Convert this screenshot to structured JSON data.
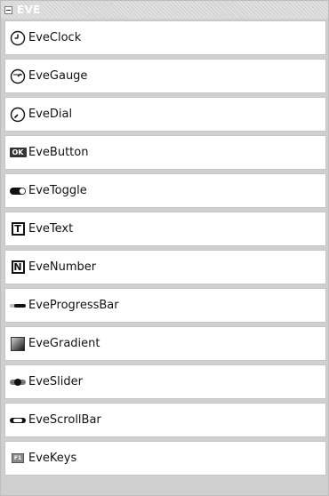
{
  "group": {
    "title": "EVE"
  },
  "items": [
    {
      "label": "EveClock",
      "icon": "clock-icon"
    },
    {
      "label": "EveGauge",
      "icon": "gauge-icon"
    },
    {
      "label": "EveDial",
      "icon": "dial-icon"
    },
    {
      "label": "EveButton",
      "icon": "ok-button-icon",
      "icon_text": "OK"
    },
    {
      "label": "EveToggle",
      "icon": "toggle-icon"
    },
    {
      "label": "EveText",
      "icon": "text-icon",
      "icon_text": "T"
    },
    {
      "label": "EveNumber",
      "icon": "number-icon",
      "icon_text": "N"
    },
    {
      "label": "EveProgressBar",
      "icon": "progress-bar-icon"
    },
    {
      "label": "EveGradient",
      "icon": "gradient-icon"
    },
    {
      "label": "EveSlider",
      "icon": "slider-icon"
    },
    {
      "label": "EveScrollBar",
      "icon": "scrollbar-icon"
    },
    {
      "label": "EveKeys",
      "icon": "keys-icon",
      "icon_text": "F1"
    }
  ]
}
